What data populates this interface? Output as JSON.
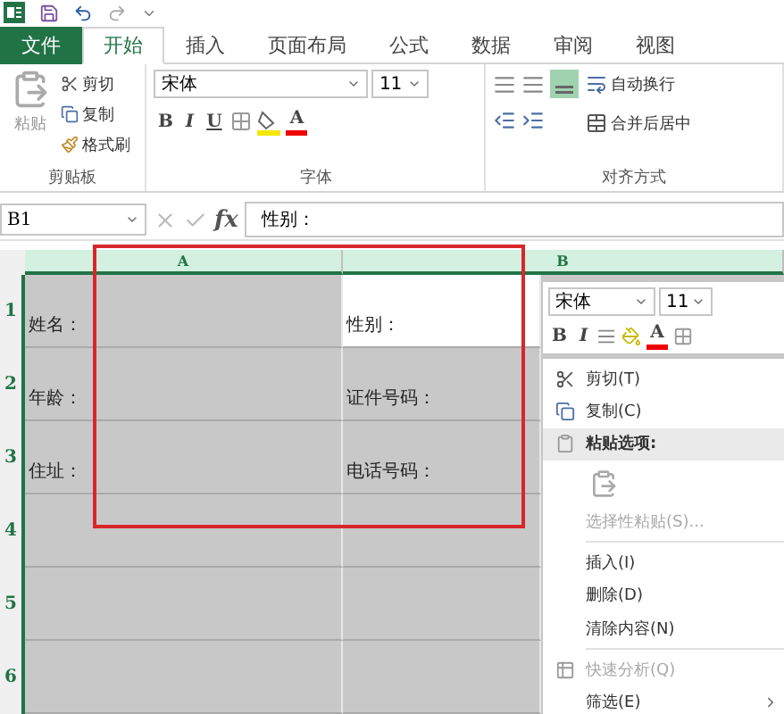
{
  "tabs": [
    {
      "label": "文件",
      "kind": "file",
      "selected": false
    },
    {
      "label": "开始",
      "kind": "tab",
      "selected": true
    },
    {
      "label": "插入",
      "kind": "tab",
      "selected": false
    },
    {
      "label": "页面布局",
      "kind": "tab",
      "selected": false
    },
    {
      "label": "公式",
      "kind": "tab",
      "selected": false
    },
    {
      "label": "数据",
      "kind": "tab",
      "selected": false
    },
    {
      "label": "审阅",
      "kind": "tab",
      "selected": false
    },
    {
      "label": "视图",
      "kind": "tab",
      "selected": false
    }
  ],
  "ribbon": {
    "clipboard": {
      "title": "剪贴板",
      "paste": "粘贴",
      "buttons": [
        "剪切",
        "复制",
        "格式刷"
      ]
    },
    "font": {
      "title": "字体",
      "font_name": "宋体",
      "font_size": "11",
      "bold": "B",
      "italic": "I",
      "underline": "U",
      "font_color": "A"
    },
    "alignment": {
      "title": "对齐方式",
      "wrap_text": "自动换行",
      "merge": "合并后居中"
    }
  },
  "formula_bar": {
    "name_box": "B1",
    "function_label": "fx",
    "content": "性别："
  },
  "sheet": {
    "columns": [
      "A",
      "B"
    ],
    "rows": [
      {
        "number": "1",
        "cells": [
          {
            "text": "姓名：",
            "active": false
          },
          {
            "text": "性别：",
            "active": true
          }
        ]
      },
      {
        "number": "2",
        "cells": [
          {
            "text": "年龄：",
            "active": false
          },
          {
            "text": "证件号码：",
            "active": false
          }
        ]
      },
      {
        "number": "3",
        "cells": [
          {
            "text": "住址：",
            "active": false
          },
          {
            "text": "电话号码：",
            "active": false
          }
        ]
      },
      {
        "number": "4",
        "cells": [
          {
            "active": false
          },
          {
            "active": false
          }
        ]
      },
      {
        "number": "5",
        "cells": [
          {
            "active": false
          },
          {
            "active": false
          }
        ]
      },
      {
        "number": "6",
        "cells": [
          {
            "active": false
          },
          {
            "active": false
          }
        ]
      }
    ]
  },
  "mini_toolbar": {
    "font_name": "宋体",
    "font_size": "11",
    "bold": "B",
    "italic": "I",
    "font_color": "A"
  },
  "context_menu": [
    {
      "kind": "item",
      "label": "剪切(T)",
      "disabled": false
    },
    {
      "kind": "item",
      "label": "复制(C)",
      "disabled": false
    },
    {
      "kind": "header",
      "label": "粘贴选项:"
    },
    {
      "kind": "paste_options"
    },
    {
      "kind": "item",
      "label": "选择性粘贴(S)...",
      "disabled": true
    },
    {
      "kind": "separator"
    },
    {
      "kind": "item",
      "label": "插入(I)",
      "disabled": false
    },
    {
      "kind": "item",
      "label": "删除(D)",
      "disabled": false
    },
    {
      "kind": "item",
      "label": "清除内容(N)",
      "disabled": false
    },
    {
      "kind": "separator"
    },
    {
      "kind": "item",
      "label": "快速分析(Q)",
      "disabled": true
    },
    {
      "kind": "item",
      "label": "筛选(E)",
      "disabled": false,
      "submenu": true
    }
  ]
}
